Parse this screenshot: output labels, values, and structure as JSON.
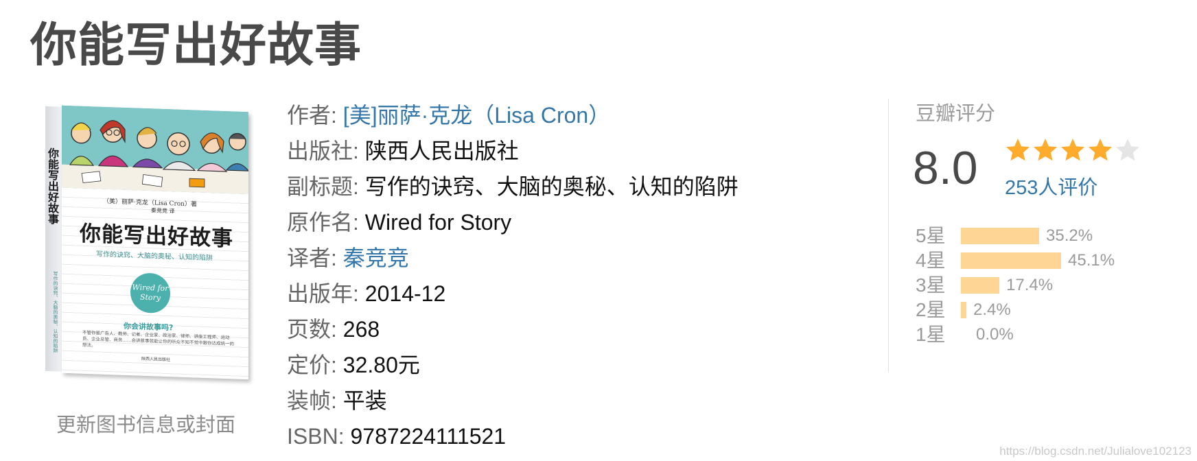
{
  "book": {
    "title": "你能写出好故事",
    "update_link": "更新图书信息或封面",
    "cover": {
      "author_line": "（美）丽萨·克龙（Lisa Cron）著",
      "translator_line": "秦竞竞 译",
      "title": "你能写出好故事",
      "subtitle": "写作的诀窍、大脑的奥秘、认知的陷阱",
      "badge": "Wired for Story",
      "question": "你会讲故事吗?",
      "blurb": "不管你是广告人、教师、记者、企业家、政治家、律师、讲座工程师、运动员、企业总管、商务……会讲故事就能让你的听众不知不觉中跟你达成统一的想法。",
      "publisher": "陕西人民出版社",
      "spine_title": "你能写出好故事",
      "spine_sub": "写作的诀窍、大脑的奥秘、认知的陷阱",
      "art_color": "#7fc6c6",
      "accent_color": "#4cb0ad"
    }
  },
  "info": {
    "author_label": "作者:",
    "author_value": "[美]丽萨·克龙（Lisa Cron）",
    "publisher_label": "出版社:",
    "publisher_value": "陕西人民出版社",
    "subtitle_label": "副标题:",
    "subtitle_value": "写作的诀窍、大脑的奥秘、认知的陷阱",
    "original_label": "原作名:",
    "original_value": "Wired for Story",
    "translator_label": "译者:",
    "translator_value": "秦竞竞",
    "pubdate_label": "出版年:",
    "pubdate_value": "2014-12",
    "pages_label": "页数:",
    "pages_value": "268",
    "price_label": "定价:",
    "price_value": "32.80元",
    "binding_label": "装帧:",
    "binding_value": "平装",
    "isbn_label": "ISBN:",
    "isbn_value": "9787224111521"
  },
  "rating": {
    "title": "豆瓣评分",
    "score": "8.0",
    "stars_filled": 4,
    "stars_total": 5,
    "count_text": "253人评价",
    "star_color": "#ffac2d",
    "star_empty_color": "#e5e5e5",
    "distribution": [
      {
        "label": "5星",
        "pct": "35.2%",
        "value": 35.2
      },
      {
        "label": "4星",
        "pct": "45.1%",
        "value": 45.1
      },
      {
        "label": "3星",
        "pct": "17.4%",
        "value": 17.4
      },
      {
        "label": "2星",
        "pct": "2.4%",
        "value": 2.4
      },
      {
        "label": "1星",
        "pct": "0.0%",
        "value": 0.0
      }
    ],
    "bar_color": "#ffd596"
  },
  "watermark": "https://blog.csdn.net/Julialove102123",
  "colors": {
    "link": "#3377aa",
    "label": "#666666",
    "title": "#494949"
  }
}
